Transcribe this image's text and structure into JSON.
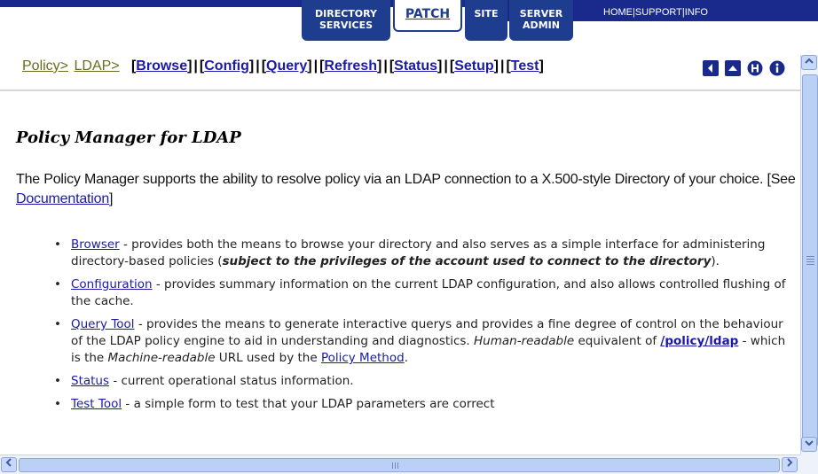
{
  "banner": {
    "tabs": [
      {
        "line1": "DIRECTORY",
        "line2": "SERVICES"
      },
      {
        "line1": "PATCH",
        "line2": ""
      },
      {
        "line1": "SITE",
        "line2": ""
      },
      {
        "line1": "SERVER",
        "line2": "ADMIN"
      }
    ],
    "links": [
      "HOME",
      "SUPPORT",
      "INFO"
    ],
    "link_separator": "|"
  },
  "nav": {
    "crumbs": [
      "Policy>",
      "LDAP>"
    ],
    "links": [
      "Browse",
      "Config",
      "Query",
      "Refresh",
      "Status",
      "Setup",
      "Test"
    ],
    "bracket_open": "[",
    "bracket_close": "]",
    "separator": "|",
    "icons": [
      "back-arrow-icon",
      "up-arrow-icon",
      "help-icon",
      "info-icon"
    ],
    "icon_color": "#1a2a8c"
  },
  "content": {
    "heading": "Policy Manager for LDAP",
    "intro_text": "The Policy Manager supports the ability to resolve policy via an LDAP connection to a X.500-style Directory of your choice. [See ",
    "intro_link": "Documentation",
    "intro_close": "]",
    "items": [
      {
        "link": "Browser",
        "text": " - provides both the means to browse your directory and also serves as a simple interface for administering directory-based policies (",
        "emphasis": "subject to the privileges of the account used to connect to the directory",
        "tail": ")."
      },
      {
        "link": "Configuration",
        "text": " - provides summary information on the current LDAP configuration, and also allows controlled flushing of the cache."
      },
      {
        "link": "Query Tool",
        "text": " - provides the means to generate interactive querys and provides a fine degree of control on the behaviour of the LDAP policy engine to aid in understanding and diagnostics. ",
        "italic1": "Human-readable",
        "text2": " equivalent of ",
        "path": "/policy/ldap",
        "text3": " - which is the ",
        "italic2": "Machine-readable",
        "text4": " URL used by the ",
        "link2": "Policy Method",
        "tail": "."
      },
      {
        "link": "Status",
        "text": " - current operational status information."
      },
      {
        "link": "Test Tool",
        "text": " - a simple form to test that your LDAP parameters are correct"
      }
    ]
  },
  "colors": {
    "banner_blue": "#1a2a8c",
    "link_blue": "#1a1aa6",
    "crumb_olive": "#6b6b1c"
  }
}
